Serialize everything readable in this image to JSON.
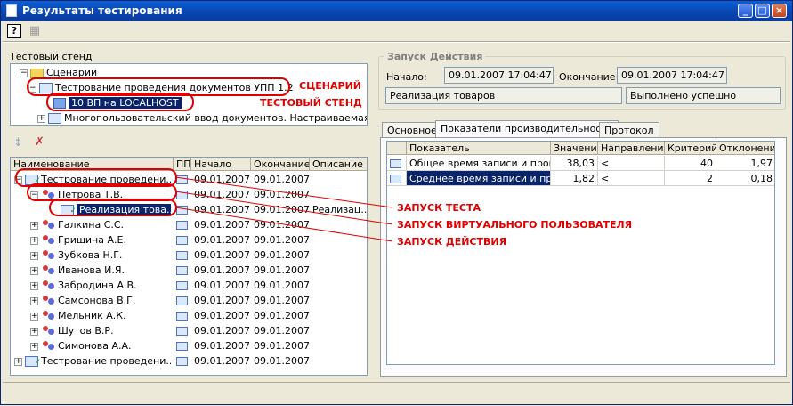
{
  "window": {
    "title": "Результаты тестирования"
  },
  "left": {
    "stand_label": "Тестовый стенд",
    "stand_tree": [
      {
        "label": "Сценарии",
        "icon": "folder-icon",
        "toggle": "−"
      },
      {
        "label": "Тестрование проведения документов УПП 1.2",
        "icon": "document-icon",
        "toggle": "−"
      },
      {
        "label": "10 ВП на LOCALHOST",
        "icon": "computer-icon",
        "toggle": ""
      },
      {
        "label": "Многопользовательский ввод документов. Настраиваемая пар...",
        "icon": "document-icon",
        "toggle": "+"
      }
    ],
    "results_columns": [
      "Наименование",
      "ПП",
      "Начало",
      "Окончание",
      "Описание"
    ],
    "results_rows": [
      {
        "name": "Тестрование проведени...",
        "start": "09.01.2007...",
        "end": "09.01.2007...",
        "desc": "",
        "toggle": "−",
        "icon": "test-icon",
        "indent": 0
      },
      {
        "name": "Петрова Т.В.",
        "start": "09.01.2007...",
        "end": "09.01.2007...",
        "desc": "",
        "toggle": "−",
        "icon": "user-icon",
        "indent": 1
      },
      {
        "name": "Реализация това...",
        "start": "09.01.2007...",
        "end": "09.01.2007...",
        "desc": "Реализац...",
        "toggle": "",
        "icon": "action-icon",
        "indent": 2
      },
      {
        "name": "Галкина С.С.",
        "start": "09.01.2007...",
        "end": "09.01.2007...",
        "desc": "",
        "toggle": "+",
        "icon": "user-icon",
        "indent": 1
      },
      {
        "name": "Гришина А.Е.",
        "start": "09.01.2007...",
        "end": "09.01.2007...",
        "desc": "",
        "toggle": "+",
        "icon": "user-icon",
        "indent": 1
      },
      {
        "name": "Зубкова Н.Г.",
        "start": "09.01.2007...",
        "end": "09.01.2007...",
        "desc": "",
        "toggle": "+",
        "icon": "user-icon",
        "indent": 1
      },
      {
        "name": "Иванова И.Я.",
        "start": "09.01.2007...",
        "end": "09.01.2007...",
        "desc": "",
        "toggle": "+",
        "icon": "user-icon",
        "indent": 1
      },
      {
        "name": "Забродина А.В.",
        "start": "09.01.2007...",
        "end": "09.01.2007...",
        "desc": "",
        "toggle": "+",
        "icon": "user-icon",
        "indent": 1
      },
      {
        "name": "Самсонова В.Г.",
        "start": "09.01.2007...",
        "end": "09.01.2007...",
        "desc": "",
        "toggle": "+",
        "icon": "user-icon",
        "indent": 1
      },
      {
        "name": "Мельник А.К.",
        "start": "09.01.2007...",
        "end": "09.01.2007...",
        "desc": "",
        "toggle": "+",
        "icon": "user-icon",
        "indent": 1
      },
      {
        "name": "Шутов В.Р.",
        "start": "09.01.2007...",
        "end": "09.01.2007...",
        "desc": "",
        "toggle": "+",
        "icon": "user-icon",
        "indent": 1
      },
      {
        "name": "Симонова А.А.",
        "start": "09.01.2007...",
        "end": "09.01.2007...",
        "desc": "",
        "toggle": "+",
        "icon": "user-icon",
        "indent": 1
      },
      {
        "name": "Тестрование проведени...",
        "start": "09.01.2007...",
        "end": "09.01.2007...",
        "desc": "",
        "toggle": "+",
        "icon": "test-icon",
        "indent": 0
      }
    ]
  },
  "right": {
    "group_title": "Запуск Действия",
    "start_label": "Начало:",
    "start_value": "09.01.2007 17:04:47",
    "end_label": "Окончание:",
    "end_value": "09.01.2007 17:04:47",
    "action_name": "Реализация товаров",
    "action_status": "Выполнено успешно",
    "tabs": [
      "Основное",
      "Показатели производительности",
      "Протокол"
    ],
    "grid_columns": [
      "Показатель",
      "Значение",
      "Направление",
      "Критерий",
      "Отклонение"
    ],
    "grid_rows": [
      {
        "name": "Общее время записи и пров...",
        "value": "38,03",
        "direction": "<",
        "criterion": "40",
        "deviation": "1,97"
      },
      {
        "name": "Среднее время записи и про...",
        "value": "1,82",
        "direction": "<",
        "criterion": "2",
        "deviation": "0,18"
      }
    ]
  },
  "annotations": {
    "scenario": "СЦЕНАРИЙ",
    "stand": "ТЕСТОВЫЙ СТЕНД",
    "test_run": "ЗАПУСК ТЕСТА",
    "vu_run": "ЗАПУСК ВИРТУАЛЬНОГО ПОЛЬЗОВАТЕЛЯ",
    "action_run": "ЗАПУСК ДЕЙСТВИЯ"
  },
  "colors": {
    "annotation": "#e00000",
    "selection": "#0a246a",
    "title_bar": "#0947b5"
  }
}
